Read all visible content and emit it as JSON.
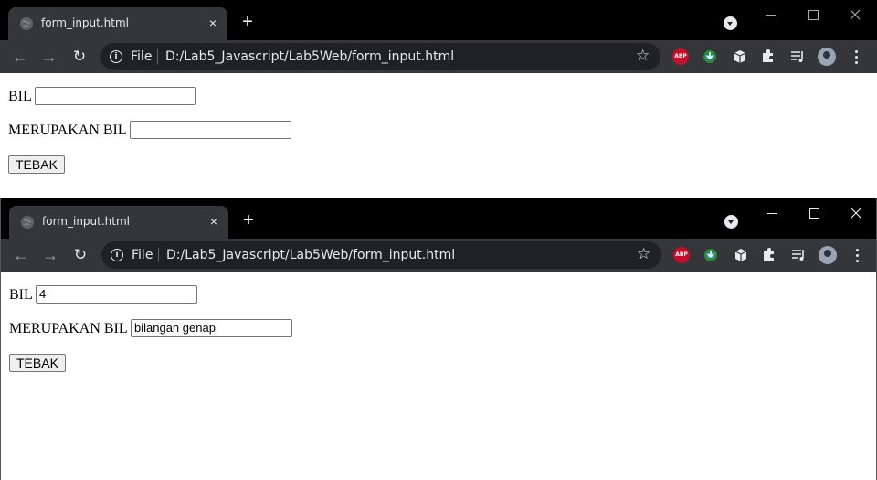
{
  "windows": [
    {
      "tab_title": "form_input.html",
      "scheme_label": "File",
      "url": "D:/Lab5_Javascript/Lab5Web/form_input.html",
      "form": {
        "bil_label": "BIL",
        "bil_value": "",
        "result_label": "MERUPAKAN BIL",
        "result_value": "",
        "button_label": "TEBAK"
      }
    },
    {
      "tab_title": "form_input.html",
      "scheme_label": "File",
      "url": "D:/Lab5_Javascript/Lab5Web/form_input.html",
      "form": {
        "bil_label": "BIL",
        "bil_value": "4",
        "result_label": "MERUPAKAN BIL",
        "result_value": "bilangan genap",
        "button_label": "TEBAK"
      }
    }
  ],
  "icons": {
    "tab_close": "×",
    "new_tab": "+",
    "back": "←",
    "forward": "→",
    "reload": "↻",
    "star": "☆",
    "puzzle": "✦",
    "info": "i",
    "abp": "ABP"
  }
}
